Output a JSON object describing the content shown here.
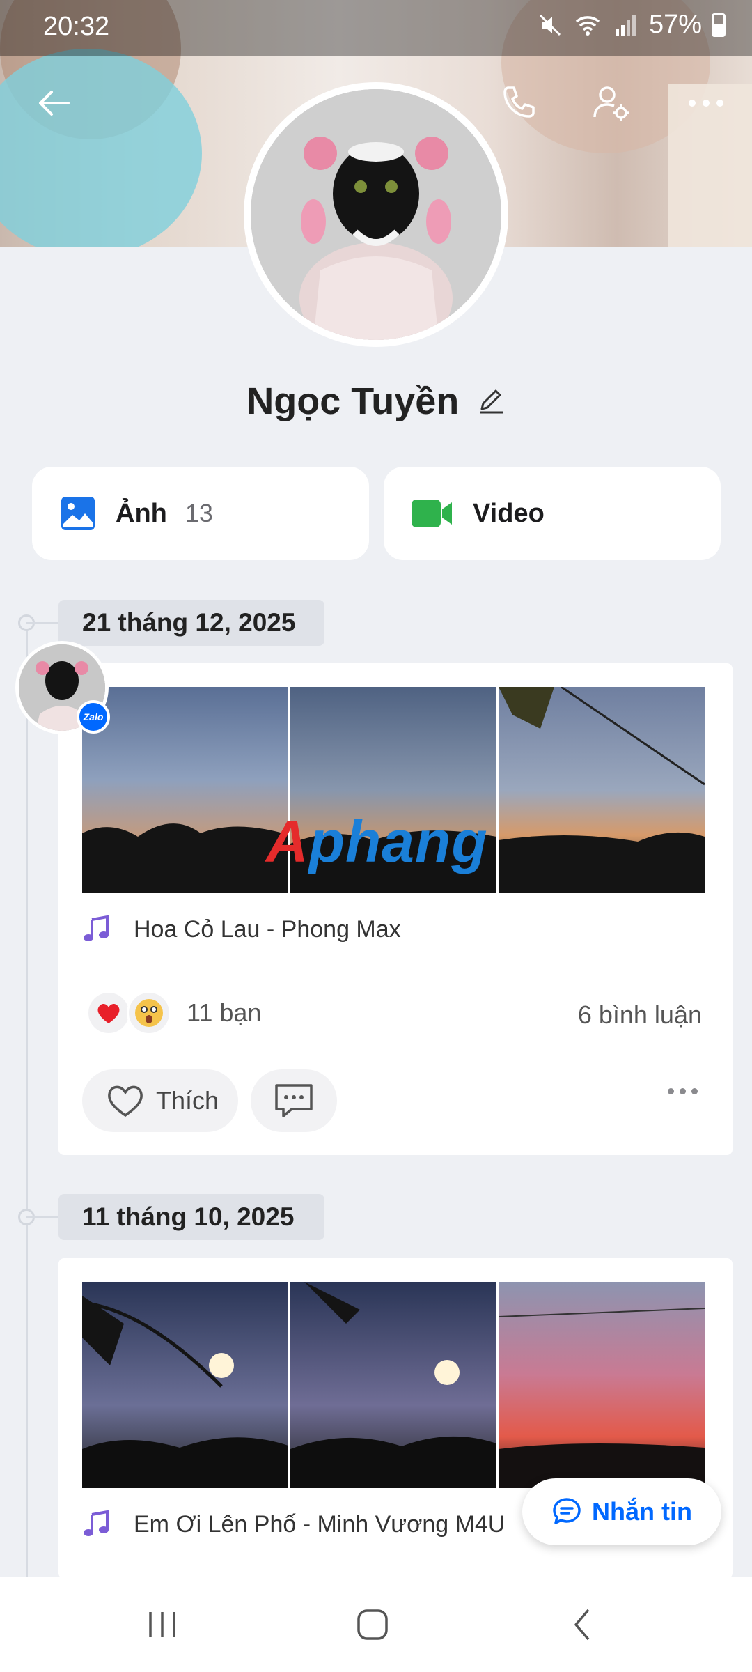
{
  "status_bar": {
    "time": "20:32",
    "battery": "57%"
  },
  "profile": {
    "name": "Ngọc Tuyền"
  },
  "media": {
    "photos_label": "Ảnh",
    "photos_count": "13",
    "video_label": "Video"
  },
  "avatar_badge": "Zalo",
  "watermark": {
    "first": "A",
    "rest": "phang"
  },
  "posts": [
    {
      "date": "21 tháng 12, 2025",
      "song": "Hoa Cỏ Lau - Phong Max",
      "friends": "11 bạn",
      "comments": "6 bình luận",
      "like_label": "Thích"
    },
    {
      "date": "11 tháng 10, 2025",
      "song": "Em Ơi Lên Phố - Minh Vương M4U"
    }
  ],
  "fab": {
    "label": "Nhắn tin"
  },
  "colors": {
    "accent": "#0068ff",
    "background": "#eef0f4",
    "music": "#7b5cd6"
  }
}
